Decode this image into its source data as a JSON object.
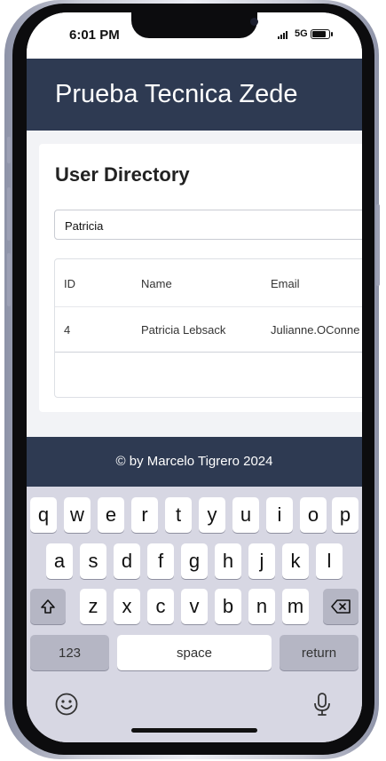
{
  "status_bar": {
    "time": "6:01 PM",
    "network": "5G"
  },
  "header": {
    "title": "Prueba Tecnica Zede"
  },
  "directory": {
    "title": "User Directory",
    "search_value": "Patricia",
    "columns": [
      "ID",
      "Name",
      "Email"
    ],
    "rows": [
      {
        "id": "4",
        "name": "Patricia Lebsack",
        "email": "Julianne.OConne"
      }
    ]
  },
  "footer": {
    "text": "© by Marcelo Tigrero 2024"
  },
  "keyboard": {
    "row1": [
      "q",
      "w",
      "e",
      "r",
      "t",
      "y",
      "u",
      "i",
      "o",
      "p"
    ],
    "row2": [
      "a",
      "s",
      "d",
      "f",
      "g",
      "h",
      "j",
      "k",
      "l"
    ],
    "row3": [
      "z",
      "x",
      "c",
      "v",
      "b",
      "n",
      "m"
    ],
    "numbers_label": "123",
    "space_label": "space",
    "return_label": "return",
    "shift_icon": "shift-arrow",
    "delete_icon": "backspace",
    "emoji_icon": "emoji",
    "mic_icon": "microphone"
  }
}
